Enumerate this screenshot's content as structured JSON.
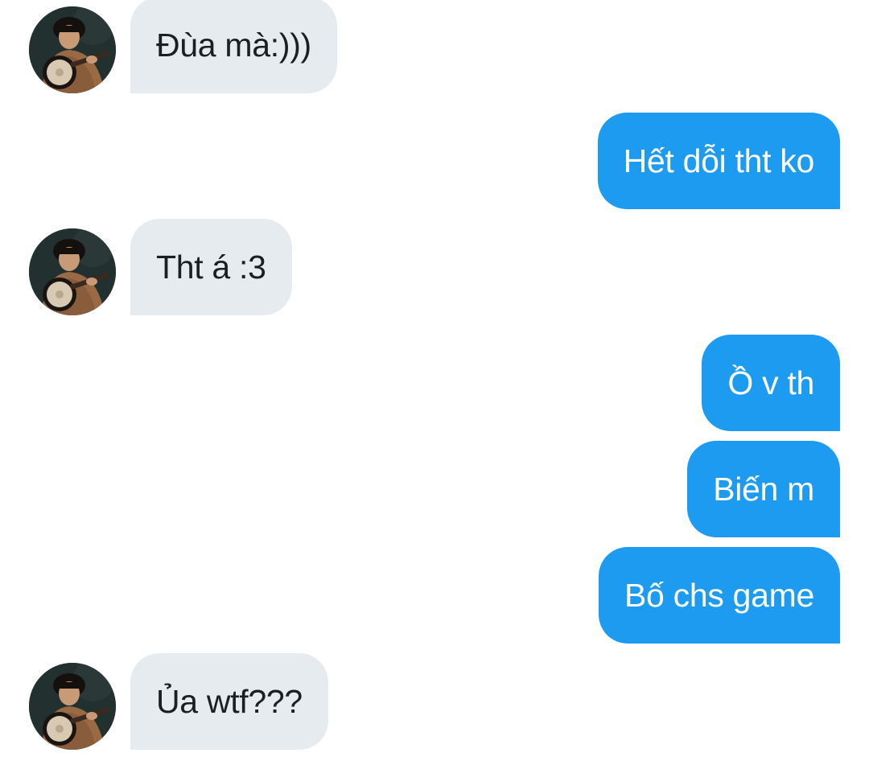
{
  "conversation": {
    "messages": [
      {
        "direction": "incoming",
        "text": "Đùa mà:)))"
      },
      {
        "direction": "outgoing",
        "text": "Hết dỗi tht ko"
      },
      {
        "direction": "incoming",
        "text": "Tht á :3"
      },
      {
        "direction": "outgoing",
        "text": "Ồ v th"
      },
      {
        "direction": "outgoing",
        "text": "Biến m"
      },
      {
        "direction": "outgoing",
        "text": "Bố chs game"
      },
      {
        "direction": "incoming",
        "text": "Ủa wtf???"
      }
    ]
  },
  "colors": {
    "incoming_bubble": "#e6ebf0",
    "outgoing_bubble": "#1d9bf0",
    "incoming_text": "#1b1f23",
    "outgoing_text": "#ffffff"
  },
  "icons": {
    "avatar": "avatar-photo"
  }
}
